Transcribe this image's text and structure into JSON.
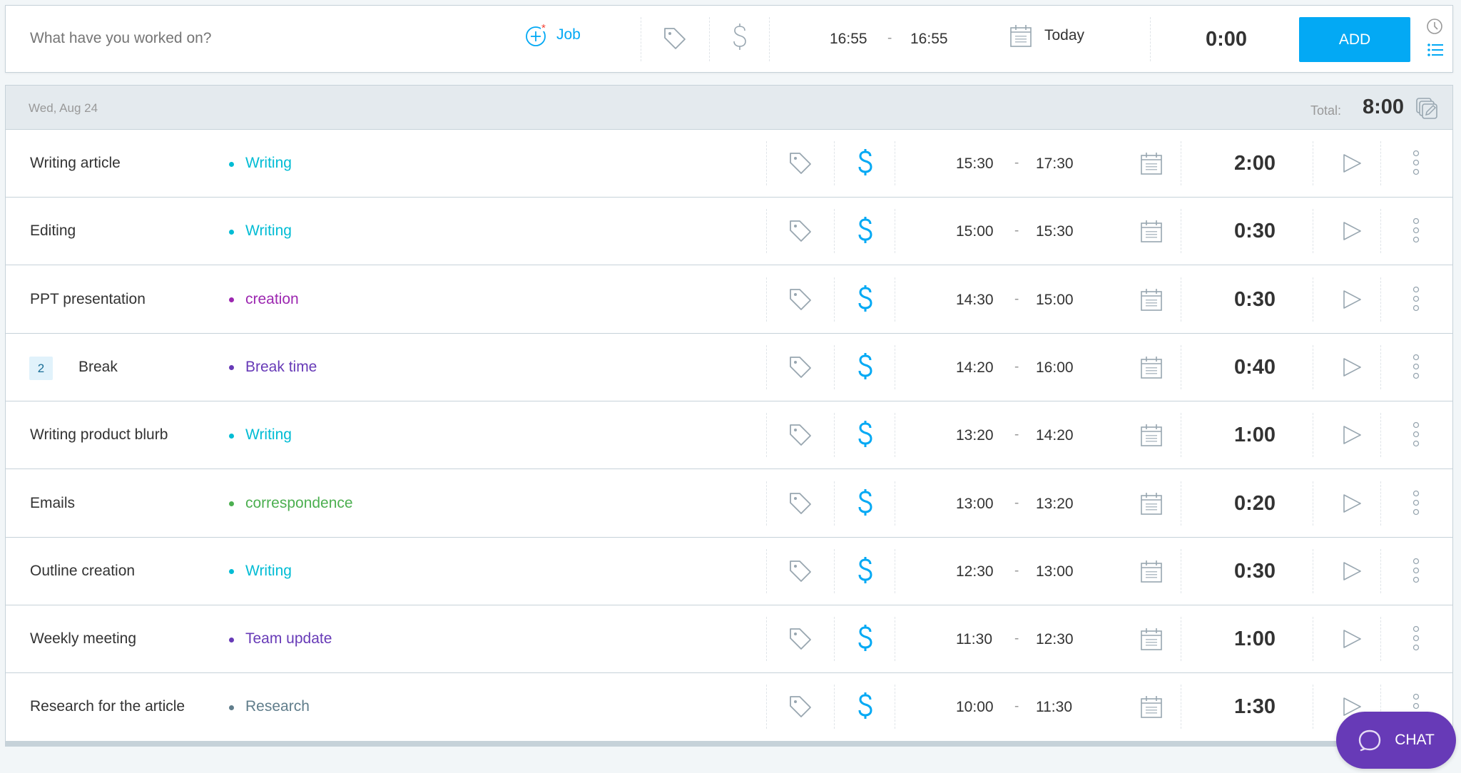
{
  "timer_bar": {
    "description_placeholder": "What have you worked on?",
    "description_value": "",
    "job_label": "Job",
    "start_time": "16:55",
    "end_time": "16:55",
    "separator": "-",
    "date_label": "Today",
    "duration": "0:00",
    "add_label": "ADD",
    "icons": {
      "job": "add-circle-icon",
      "tag": "tag-icon",
      "billable": "dollar-icon",
      "calendar": "calendar-icon",
      "timer_mode": "clock-icon",
      "manual_mode": "list-icon"
    }
  },
  "day_group": {
    "date": "Wed, Aug 24",
    "total_label": "Total:",
    "total_value": "8:00",
    "bulk_edit_icon": "bulk-edit-icon"
  },
  "colors": {
    "accent": "#03a9f4",
    "job_required": "#f44336",
    "chat": "#673ab7",
    "header_bg": "#e4eaee"
  },
  "entries": [
    {
      "description": "Writing article",
      "project": "Writing",
      "project_color": "#00bcd4",
      "start": "15:30",
      "end": "17:30",
      "duration": "2:00"
    },
    {
      "description": "Editing",
      "project": "Writing",
      "project_color": "#00bcd4",
      "start": "15:00",
      "end": "15:30",
      "duration": "0:30"
    },
    {
      "description": "PPT presentation",
      "project": "creation",
      "project_color": "#9c27b0",
      "start": "14:30",
      "end": "15:00",
      "duration": "0:30"
    },
    {
      "description": "Break",
      "badge": "2",
      "project": "Break time",
      "project_color": "#673ab7",
      "start": "14:20",
      "end": "16:00",
      "duration": "0:40"
    },
    {
      "description": "Writing product blurb",
      "project": "Writing",
      "project_color": "#00bcd4",
      "start": "13:20",
      "end": "14:20",
      "duration": "1:00"
    },
    {
      "description": "Emails",
      "project": "correspondence",
      "project_color": "#4caf50",
      "start": "13:00",
      "end": "13:20",
      "duration": "0:20"
    },
    {
      "description": "Outline creation",
      "project": "Writing",
      "project_color": "#00bcd4",
      "start": "12:30",
      "end": "13:00",
      "duration": "0:30"
    },
    {
      "description": "Weekly meeting",
      "project": "Team update",
      "project_color": "#673ab7",
      "start": "11:30",
      "end": "12:30",
      "duration": "1:00"
    },
    {
      "description": "Research for the article",
      "project": "Research",
      "project_color": "#607d8b",
      "start": "10:00",
      "end": "11:30",
      "duration": "1:30"
    }
  ],
  "chat": {
    "label": "CHAT",
    "icon": "chat-bubble-icon"
  }
}
